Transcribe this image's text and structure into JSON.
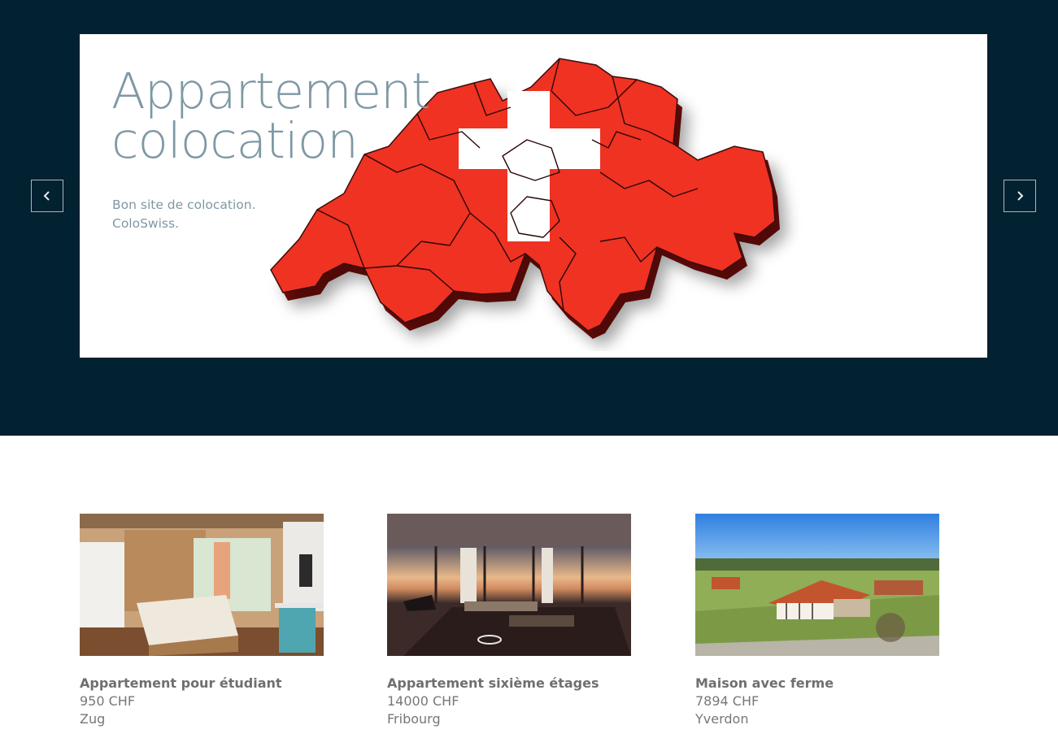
{
  "slider": {
    "title_line1": "Appartement",
    "title_line2": "colocation",
    "text_line1": "Bon site de colocation.",
    "text_line2": "ColoSwiss.",
    "image": "switzerland-flag-map",
    "prev_icon": "chevron-left-icon",
    "next_icon": "chevron-right-icon"
  },
  "listings": [
    {
      "title": "Appartement pour étudiant",
      "price": "950 CHF",
      "city": "Zug",
      "image": "bedroom-photo"
    },
    {
      "title": "Appartement sixième étages",
      "price": "14000 CHF",
      "city": "Fribourg",
      "image": "living-room-photo"
    },
    {
      "title": "Maison avec ferme",
      "price": "7894 CHF",
      "city": "Yverdon",
      "image": "farmhouse-photo"
    }
  ],
  "colors": {
    "hero_bg": "#022131",
    "slide_text": "#7e98a4",
    "flag_red": "#ef3124",
    "card_text": "#777777"
  }
}
